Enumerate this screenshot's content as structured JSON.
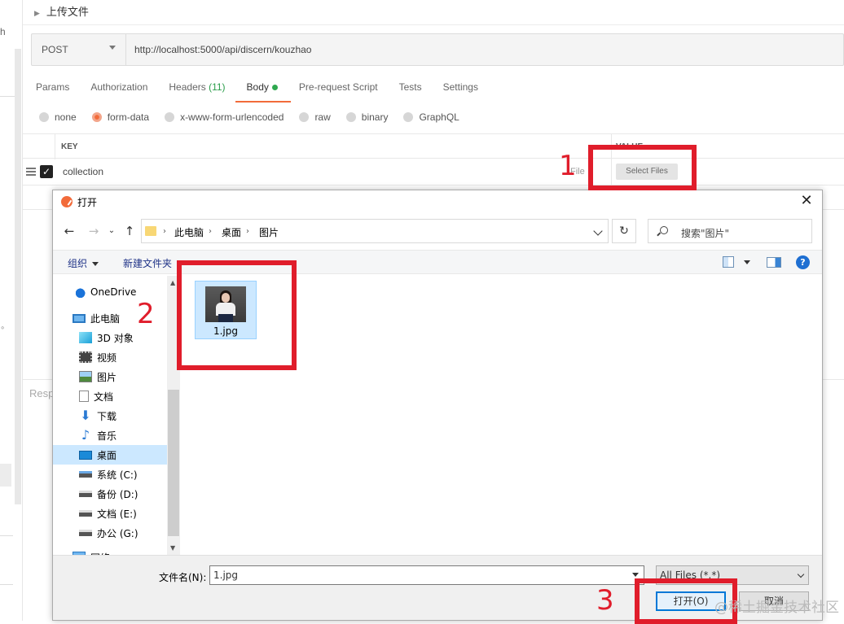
{
  "postman": {
    "sidebar_letter": "h",
    "request_title": "上传文件",
    "method": "POST",
    "url": "http://localhost:5000/api/discern/kouzhao",
    "tabs": [
      {
        "label": "Params"
      },
      {
        "label": "Authorization"
      },
      {
        "label": "Headers",
        "count": "(11)"
      },
      {
        "label": "Body",
        "active": true
      },
      {
        "label": "Pre-request Script"
      },
      {
        "label": "Tests"
      },
      {
        "label": "Settings"
      }
    ],
    "body_types": [
      "none",
      "form-data",
      "x-www-form-urlencoded",
      "raw",
      "binary",
      "GraphQL"
    ],
    "selected_body_type": "form-data",
    "table": {
      "key_header": "KEY",
      "value_header": "VALUE",
      "row": {
        "key": "collection",
        "type": "File",
        "button": "Select Files",
        "checked": true
      }
    },
    "response_label": "Resp"
  },
  "dialog": {
    "title": "打开",
    "breadcrumbs": [
      "此电脑",
      "桌面",
      "图片"
    ],
    "search_placeholder": "搜索\"图片\"",
    "toolbar": {
      "organize": "组织",
      "new_folder": "新建文件夹"
    },
    "tree": [
      {
        "label": "OneDrive",
        "icon": "onedrive-icon"
      },
      {
        "label": "此电脑",
        "icon": "computer-icon"
      },
      {
        "label": "3D 对象",
        "icon": "3d-objects-icon"
      },
      {
        "label": "视频",
        "icon": "video-icon"
      },
      {
        "label": "图片",
        "icon": "pictures-icon"
      },
      {
        "label": "文档",
        "icon": "documents-icon"
      },
      {
        "label": "下载",
        "icon": "download-icon"
      },
      {
        "label": "音乐",
        "icon": "music-icon"
      },
      {
        "label": "桌面",
        "icon": "desktop-icon",
        "selected": true
      },
      {
        "label": "系统 (C:)",
        "icon": "drive-icon"
      },
      {
        "label": "备份 (D:)",
        "icon": "drive-icon"
      },
      {
        "label": "文档 (E:)",
        "icon": "drive-icon"
      },
      {
        "label": "办公 (G:)",
        "icon": "drive-icon"
      },
      {
        "label": "网络",
        "icon": "network-icon"
      }
    ],
    "files": [
      {
        "name": "1.jpg",
        "selected": true
      }
    ],
    "filename_label": "文件名(N):",
    "filename_value": "1.jpg",
    "filetype_value": "All Files (*.*)",
    "open_button": "打开(O)",
    "cancel_button": "取消"
  },
  "annotations": {
    "steps": [
      "1",
      "2",
      "3"
    ],
    "color": "#e01d2b"
  },
  "watermark": "@稀土掘金技术社区",
  "colors": {
    "accent": "#f26b3a",
    "selection": "#cce8ff",
    "link": "#1e3287"
  }
}
